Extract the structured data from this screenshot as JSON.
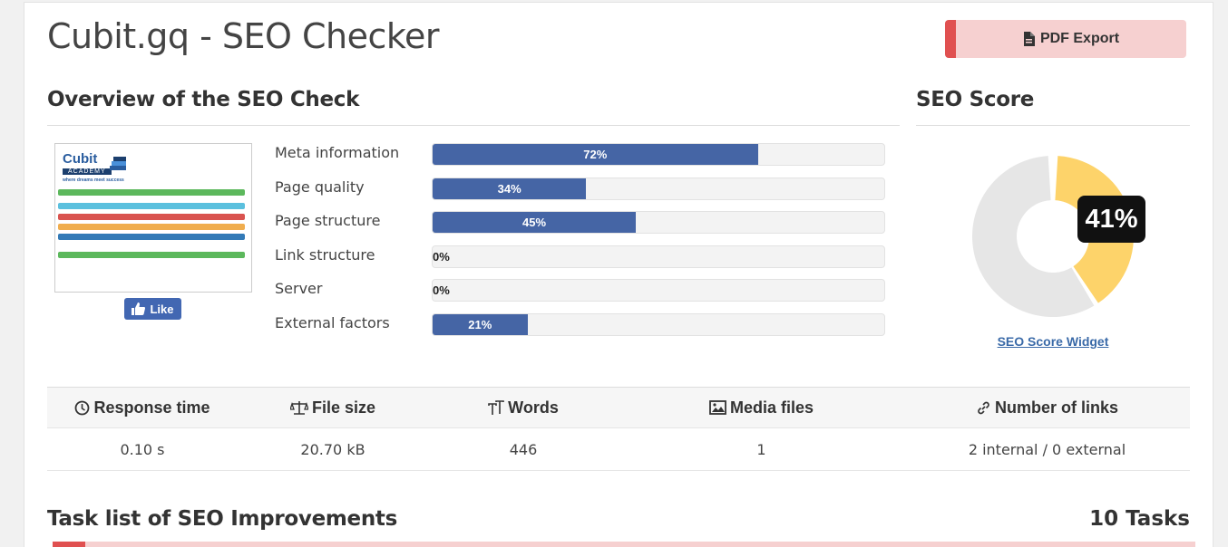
{
  "header": {
    "title": "Cubit.gq - SEO Checker",
    "pdf_label": "PDF Export"
  },
  "overview": {
    "heading": "Overview of the SEO Check",
    "like_label": "Like",
    "thumbnail": {
      "logo": "Cubit",
      "sub": "ACADEMY",
      "tagline": "where dreams meet success"
    },
    "metrics": [
      {
        "label": "Meta information",
        "value": 72,
        "display": "72%"
      },
      {
        "label": "Page quality",
        "value": 34,
        "display": "34%"
      },
      {
        "label": "Page structure",
        "value": 45,
        "display": "45%"
      },
      {
        "label": "Link structure",
        "value": 0,
        "display": "0%"
      },
      {
        "label": "Server",
        "value": 0,
        "display": "0%"
      },
      {
        "label": "External factors",
        "value": 21,
        "display": "21%"
      }
    ]
  },
  "score": {
    "heading": "SEO Score",
    "value": 41,
    "display": "41%",
    "widget_link": "SEO Score Widget",
    "colors": {
      "fill": "#fdd36a",
      "rest": "#e6e6e6"
    }
  },
  "stats": {
    "headers": [
      {
        "label": "Response time",
        "icon": "clock-icon"
      },
      {
        "label": "File size",
        "icon": "scale-icon"
      },
      {
        "label": "Words",
        "icon": "text-size-icon"
      },
      {
        "label": "Media files",
        "icon": "image-icon"
      },
      {
        "label": "Number of links",
        "icon": "link-icon"
      }
    ],
    "values": [
      "0.10 s",
      "20.70 kB",
      "446",
      "1",
      "2 internal / 0 external"
    ]
  },
  "tasks": {
    "heading": "Task list of SEO Improvements",
    "count": "10 Tasks"
  }
}
